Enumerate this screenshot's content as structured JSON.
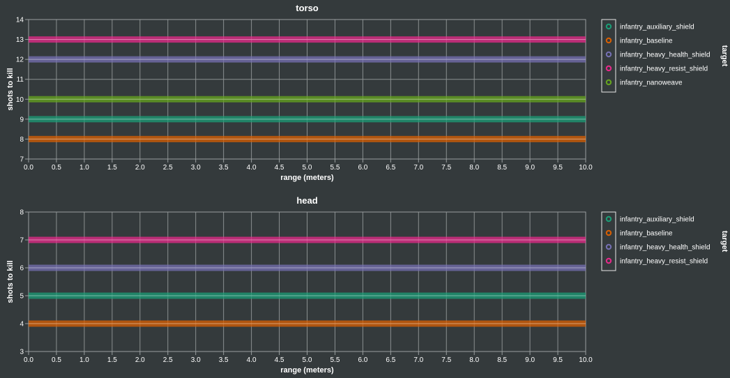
{
  "chart_data": [
    {
      "type": "line",
      "title": "torso",
      "xlabel": "range (meters)",
      "ylabel": "shots to kill",
      "xlim": [
        0,
        10
      ],
      "ylim": [
        7,
        14
      ],
      "x_ticks": [
        "0.0",
        "0.5",
        "1.0",
        "1.5",
        "2.0",
        "2.5",
        "3.0",
        "3.5",
        "4.0",
        "4.5",
        "5.0",
        "5.5",
        "6.0",
        "6.5",
        "7.0",
        "7.5",
        "8.0",
        "8.5",
        "9.0",
        "9.5",
        "10.0"
      ],
      "y_ticks": [
        "7",
        "8",
        "9",
        "10",
        "11",
        "12",
        "13",
        "14"
      ],
      "grid": true,
      "legend_title": "target",
      "legend_position": "right",
      "series": [
        {
          "name": "infantry_auxiliary_shield",
          "color": "#1b9e77",
          "x": [
            0,
            10
          ],
          "y": [
            9,
            9
          ]
        },
        {
          "name": "infantry_baseline",
          "color": "#d95f02",
          "x": [
            0,
            10
          ],
          "y": [
            8,
            8
          ]
        },
        {
          "name": "infantry_heavy_health_shield",
          "color": "#7570b3",
          "x": [
            0,
            10
          ],
          "y": [
            12,
            12
          ]
        },
        {
          "name": "infantry_heavy_resist_shield",
          "color": "#e7298a",
          "x": [
            0,
            10
          ],
          "y": [
            13,
            13
          ]
        },
        {
          "name": "infantry_nanoweave",
          "color": "#66a61e",
          "x": [
            0,
            10
          ],
          "y": [
            10,
            10
          ]
        }
      ]
    },
    {
      "type": "line",
      "title": "head",
      "xlabel": "range (meters)",
      "ylabel": "shots to kill",
      "xlim": [
        0,
        10
      ],
      "ylim": [
        3,
        8
      ],
      "x_ticks": [
        "0.0",
        "0.5",
        "1.0",
        "1.5",
        "2.0",
        "2.5",
        "3.0",
        "3.5",
        "4.0",
        "4.5",
        "5.0",
        "5.5",
        "6.0",
        "6.5",
        "7.0",
        "7.5",
        "8.0",
        "8.5",
        "9.0",
        "9.5",
        "10.0"
      ],
      "y_ticks": [
        "3",
        "4",
        "5",
        "6",
        "7",
        "8"
      ],
      "grid": true,
      "legend_title": "target",
      "legend_position": "right",
      "series": [
        {
          "name": "infantry_auxiliary_shield",
          "color": "#1b9e77",
          "x": [
            0,
            10
          ],
          "y": [
            5,
            5
          ]
        },
        {
          "name": "infantry_baseline",
          "color": "#d95f02",
          "x": [
            0,
            10
          ],
          "y": [
            4,
            4
          ]
        },
        {
          "name": "infantry_heavy_health_shield",
          "color": "#7570b3",
          "x": [
            0,
            10
          ],
          "y": [
            6,
            6
          ]
        },
        {
          "name": "infantry_heavy_resist_shield",
          "color": "#e7298a",
          "x": [
            0,
            10
          ],
          "y": [
            7,
            7
          ]
        }
      ]
    }
  ]
}
